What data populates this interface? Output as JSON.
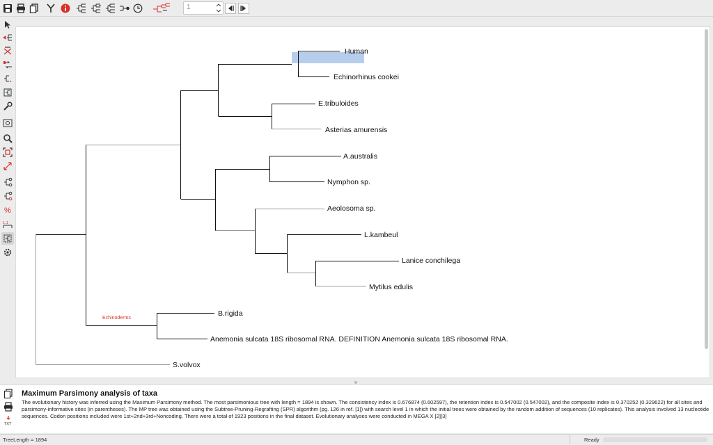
{
  "toolbar": {
    "zoom_value": "1",
    "icons": [
      "save-icon",
      "print-icon",
      "copy-icon",
      "filter-icon",
      "info-icon",
      "tree-rect-icon",
      "tree-slanted-icon",
      "tree-curved-icon",
      "tree-radiation-icon",
      "tree-circle-icon",
      "tree-topology-icon",
      "zoom-stepper",
      "back-icon",
      "forward-icon"
    ]
  },
  "sidebar": {
    "icons": [
      "select-pointer-icon",
      "place-root-icon",
      "flip-subtree-icon",
      "swap-subtree-icon",
      "compress-subtree-icon",
      "tree-edit-icon",
      "wrench-icon",
      "search-window-icon",
      "zoom-icon",
      "fit-window-icon",
      "resize-icon",
      "branch-length-icon",
      "bootstrap-icon",
      "percent-icon",
      "scale-bar-icon",
      "tree-options-icon",
      "gear-icon"
    ],
    "selected_index": 15
  },
  "tree": {
    "leaves": [
      "Human",
      "Echinorhinus cookei",
      "E.tribuloides",
      "Asterias amurensis",
      "A.australis",
      "Nymphon sp.",
      "Aeolosoma sp.",
      "L.kambeul",
      "Lanice conchilega",
      "Mytilus edulis",
      "B.rigida",
      "Anemonia sulcata 18S ribosomal RNA. DEFINITION Anemonia sulcata 18S ribosomal RNA.",
      "S.volvox"
    ],
    "clade_label": "Echinoderms",
    "highlight_color": "#b7cdec"
  },
  "caption": {
    "title": "Maximum Parsimony analysis of taxa",
    "text": "The evolutionary history was inferred using the Maximum Parsimony method. The most parsimonious tree with length = 1894 is shown. The consistency index is 0.676874 (0.602597), the retention index is 0.547002 (0.547002), and the composite index is 0.370252 (0.329622) for all sites and parsimony-informative sites (in parentheses). The MP tree was obtained using the Subtree-Pruning-Regrafting (SPR) algorithm (pg. 126 in ref. [1]) with search level 1 in which the initial trees were obtained by the random addition of sequences (10 replicates). This analysis involved 13 nucleotide sequences. Codon positions included were 1st+2nd+3rd+Noncoding. There were a total of 1923 positions in the final dataset. Evolutionary analyses were conducted in MEGA X [2][3]",
    "icons": [
      "copy-caption-icon",
      "print-caption-icon",
      "export-txt-icon"
    ]
  },
  "status": {
    "left": "TreeLength = 1894",
    "right": "Ready"
  }
}
